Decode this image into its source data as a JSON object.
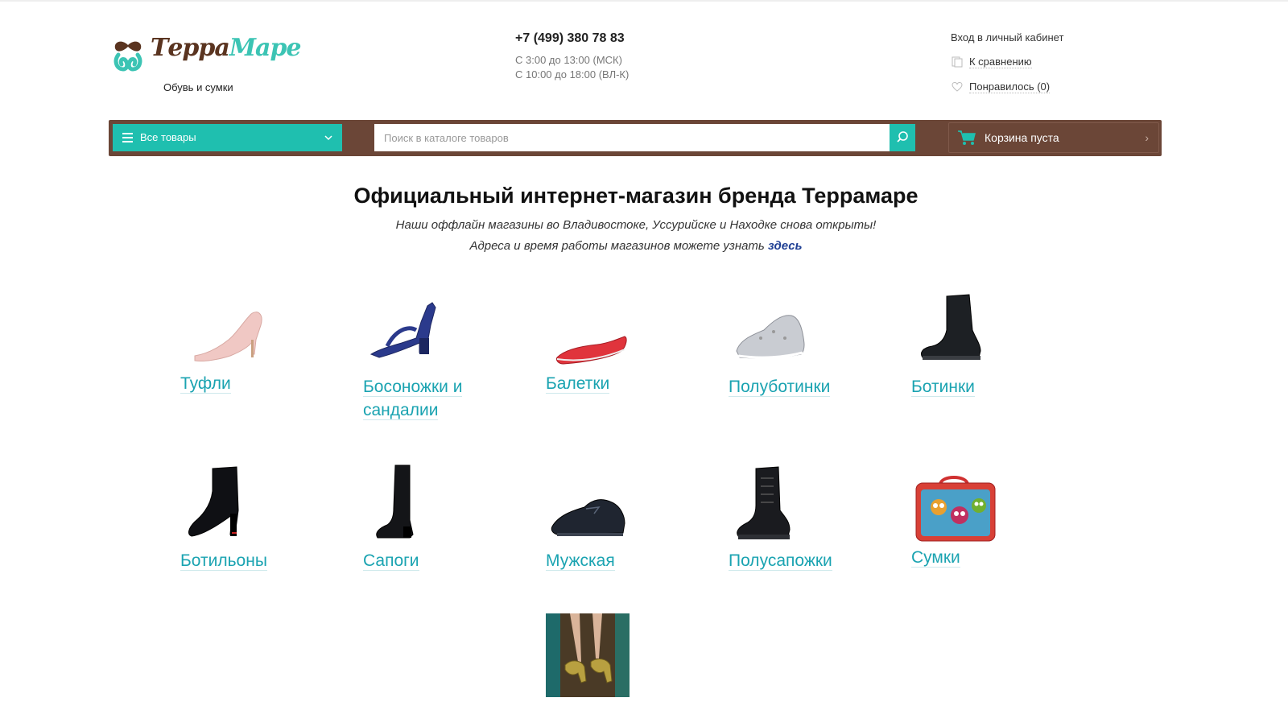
{
  "header": {
    "logo_word1": "Терра",
    "logo_word2": "Маре",
    "logo_tagline": "Обувь и сумки",
    "phone": "+7 (499) 380 78 83",
    "hours_line1": "С 3:00 до 13:00 (МСК)",
    "hours_line2": "С 10:00 до 18:00 (ВЛ-К)",
    "login_link": "Вход в личный кабинет",
    "compare_link": "К сравнению",
    "favorites_link": "Понравилось (0)"
  },
  "navbar": {
    "all_goods": "Все товары",
    "search_placeholder": "Поиск в каталоге товаров",
    "cart_label": "Корзина пуста"
  },
  "intro": {
    "title": "Официальный интернет-магазин бренда Террамаре",
    "line1": "Наши оффлайн магазины во Владивостоке, Уссурийске и Находке снова открыты!",
    "line2": "Адреса и время работы магазинов можете узнать",
    "line2_link": "здесь"
  },
  "categories": [
    {
      "label": "Туфли",
      "icon": "pumps-shoe"
    },
    {
      "label": "Босоножки и сандалии",
      "icon": "sandal"
    },
    {
      "label": "Балетки",
      "icon": "ballet-flat"
    },
    {
      "label": "Полуботинки",
      "icon": "sneaker"
    },
    {
      "label": "Ботинки",
      "icon": "ankle-boot"
    },
    {
      "label": "Ботильоны",
      "icon": "heeled-bootie"
    },
    {
      "label": "Сапоги",
      "icon": "tall-boot"
    },
    {
      "label": "Мужская",
      "icon": "mens-shoe"
    },
    {
      "label": "Полусапожки",
      "icon": "combat-boot"
    },
    {
      "label": "Сумки",
      "icon": "handbag"
    },
    {
      "label": "",
      "icon": "shoes-photo"
    }
  ],
  "colors": {
    "accent": "#1fbfaf",
    "navbar": "#6b4637",
    "category_link": "#1aa3b1",
    "intro_link": "#1f3f94"
  }
}
